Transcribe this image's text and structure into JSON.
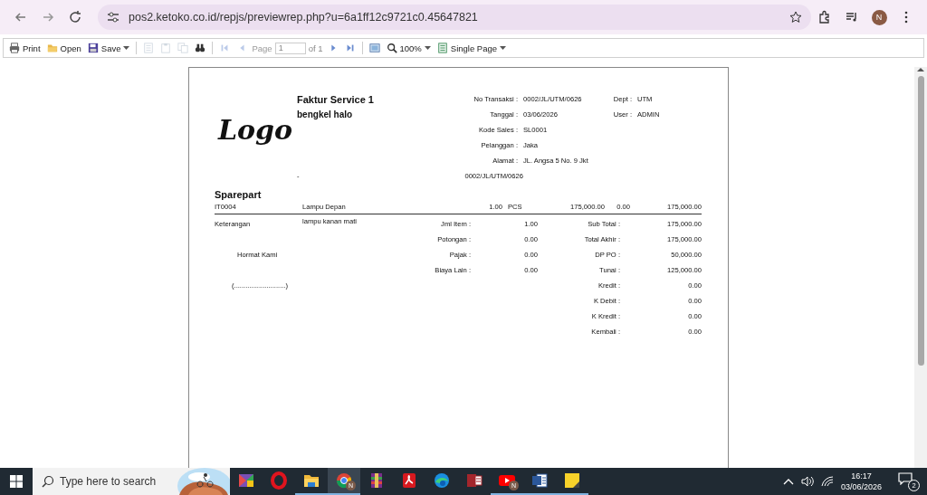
{
  "browser": {
    "url": "pos2.ketoko.co.id/repjs/previewrep.php?u=6a1ff12c9721c0.45647821",
    "avatar": "N"
  },
  "viewer_toolbar": {
    "items": [
      {
        "kind": "print",
        "label": "Print",
        "disabled": false
      },
      {
        "kind": "open",
        "label": "Open",
        "disabled": false
      },
      {
        "kind": "save",
        "label": "Save",
        "disabled": false,
        "dropdown": true
      },
      {
        "kind": "sep"
      },
      {
        "kind": "doc",
        "disabled": true
      },
      {
        "kind": "clip",
        "disabled": true
      },
      {
        "kind": "copy",
        "disabled": true
      },
      {
        "kind": "find",
        "disabled": false
      },
      {
        "kind": "sep"
      },
      {
        "kind": "first",
        "disabled": true
      },
      {
        "kind": "prev",
        "disabled": true
      },
      {
        "kind": "page",
        "label": "Page",
        "value": "1",
        "total": "of 1"
      },
      {
        "kind": "next",
        "disabled": false
      },
      {
        "kind": "last",
        "disabled": false
      },
      {
        "kind": "sep"
      },
      {
        "kind": "view",
        "disabled": false
      },
      {
        "kind": "zoom",
        "label": "100%",
        "disabled": false,
        "dropdown": true
      },
      {
        "kind": "pages",
        "label": "Single Page",
        "disabled": false,
        "dropdown": true
      }
    ]
  },
  "report": {
    "logo": "Logo",
    "title": "Faktur Service 1",
    "company": "bengkel halo",
    "info": [
      {
        "label": "No Transaksi :",
        "value": "0002/JL/UTM/0626",
        "label2": "Dept :",
        "value2": "UTM"
      },
      {
        "label": "Tanggal :",
        "value": "03/06/2026",
        "label2": "User :",
        "value2": "ADMIN"
      },
      {
        "label": "Kode Sales :",
        "value": "SL0001"
      },
      {
        "label": "Pelanggan :",
        "value": "Jaka"
      },
      {
        "label": "Alamat :",
        "value": "JL. Angsa 5 No. 9 Jkt"
      }
    ],
    "dash": "-",
    "ref": "0002/JL/UTM/0626",
    "section": "Sparepart",
    "items": [
      {
        "code": "IT0004",
        "name": "Lampu Depan",
        "qty": "1.00",
        "unit": "PCS",
        "price": "175,000.00",
        "discount": "0.00",
        "total": "175,000.00"
      }
    ],
    "note_label": "Keterangan",
    "note": "lampu kanan mati",
    "regards": "Hormat Kami",
    "signature": "(...........................)",
    "summary_left": [
      {
        "label": "Jml Item :",
        "value": "1.00"
      },
      {
        "label": "Potongan :",
        "value": "0.00"
      },
      {
        "label": "Pajak :",
        "value": "0.00"
      },
      {
        "label": "Biaya Lain :",
        "value": "0.00"
      }
    ],
    "summary_right": [
      {
        "label": "Sub Total :",
        "value": "175,000.00"
      },
      {
        "label": "Total Akhir :",
        "value": "175,000.00"
      },
      {
        "label": "DP PO :",
        "value": "50,000.00"
      },
      {
        "label": "Tunai :",
        "value": "125,000.00"
      },
      {
        "label": "Kredit :",
        "value": "0.00"
      },
      {
        "label": "K Debit :",
        "value": "0.00"
      },
      {
        "label": "K Kredit  :",
        "value": "0.00"
      },
      {
        "label": "Kembali :",
        "value": "0.00"
      }
    ]
  },
  "taskbar": {
    "search_placeholder": "Type here to search",
    "apps": [
      {
        "kind": "palette",
        "running": false,
        "selected": false
      },
      {
        "kind": "ring",
        "running": false,
        "selected": false
      },
      {
        "kind": "folder",
        "running": true,
        "selected": false
      },
      {
        "kind": "browser",
        "running": true,
        "selected": true,
        "badge": "N"
      },
      {
        "kind": "archive",
        "running": false,
        "selected": false
      },
      {
        "kind": "pdf",
        "running": false,
        "selected": false
      },
      {
        "kind": "wave",
        "running": false,
        "selected": false
      },
      {
        "kind": "database",
        "running": false,
        "selected": false
      },
      {
        "kind": "play",
        "running": true,
        "selected": false,
        "badge": "N"
      },
      {
        "kind": "document",
        "running": true,
        "selected": false
      },
      {
        "kind": "note",
        "running": true,
        "selected": false
      }
    ],
    "time": "16:17",
    "date": "03/06/2026",
    "notifications": "2"
  }
}
